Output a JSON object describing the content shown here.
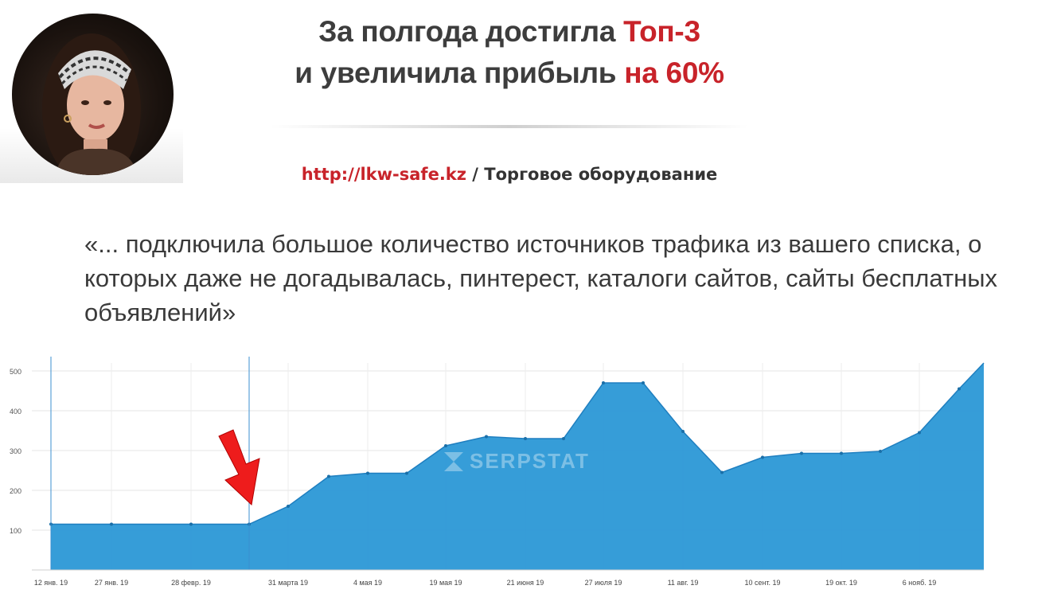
{
  "headline": {
    "line1_prefix": "За полгода достигла ",
    "line1_highlight": "Топ-3",
    "line2_prefix": "и увеличила прибыль ",
    "line2_highlight": "на 60%"
  },
  "site": {
    "url": "http://lkw-safe.kz",
    "separator": " / ",
    "category": "Торговое оборудование"
  },
  "quote": "«... подключила большое количество источников трафика из вашего списка, о которых даже не догадывалась, пинтерест, каталоги сайтов, сайты бесплатных объявлений»",
  "colors": {
    "accent_red": "#c8232a",
    "area_fill": "#2b98d6",
    "line": "#1f7fc0",
    "arrow": "#ee1c1c"
  },
  "chart_data": {
    "type": "area",
    "watermark": "SERPSTAT",
    "x": [
      "12 янв. 19",
      "27 янв. 19",
      "28 февр. 19",
      "12 марта 19",
      "31 марта 19",
      "13 апр. 19",
      "4 мая 19",
      "19 мая 19",
      "1 июня 19",
      "21 июня 19",
      "7 июля 19",
      "27 июля 19",
      "1 авг. 19",
      "11 авг. 19",
      "25 авг. 19",
      "10 сент. 19",
      "19 сент. 19",
      "19 окт. 19",
      "25 окт. 19",
      "6 нояб. 19",
      "15 нояб. 19",
      "30 нояб. 19"
    ],
    "values": [
      115,
      115,
      115,
      115,
      160,
      235,
      243,
      243,
      312,
      335,
      330,
      330,
      470,
      470,
      348,
      245,
      283,
      293,
      293,
      298,
      345,
      455
    ],
    "xtick_labels": [
      "12 янв. 19",
      "27 янв. 19",
      "28 февр. 19",
      "31 марта 19",
      "4 мая 19",
      "19 мая 19",
      "21 июня 19",
      "27 июля 19",
      "11 авг. 19",
      "10 сент. 19",
      "19 окт. 19",
      "6 нояб. 19"
    ],
    "ytick_labels": [
      "100",
      "200",
      "300",
      "400",
      "500"
    ],
    "ylim": [
      0,
      520
    ],
    "grid": true,
    "markers": [
      "12 янв. 19",
      "12 марта 19"
    ],
    "annotation": "red arrow pointing down at 12 марта 19"
  }
}
